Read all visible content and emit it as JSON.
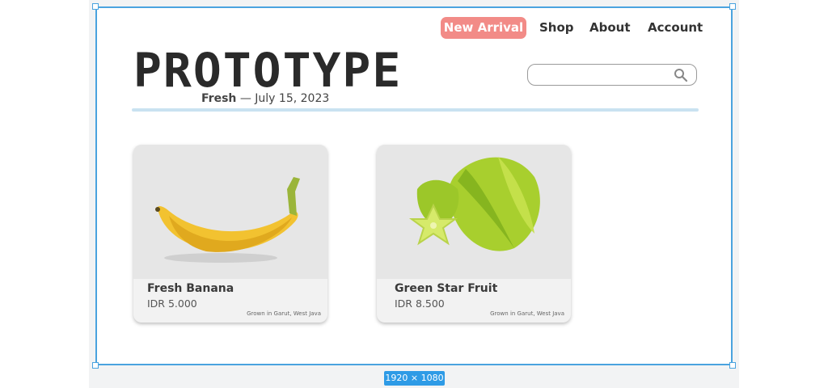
{
  "canvas": {
    "size_label": "1920 × 1080"
  },
  "nav": {
    "items": [
      {
        "label": "New Arrival",
        "highlighted": true,
        "color": "#f28b87"
      },
      {
        "label": "Shop"
      },
      {
        "label": "About"
      },
      {
        "label": "Account"
      }
    ]
  },
  "header": {
    "logo": "PROTOTYPE",
    "tagline_bold": "Fresh",
    "tagline_sep": "—",
    "tagline_date": "July 15, 2023"
  },
  "search": {
    "placeholder": "",
    "icon": "search-icon"
  },
  "products": [
    {
      "name": "Fresh Banana",
      "price": "IDR 5.000",
      "origin": "Grown in Garut, West Java",
      "image": "banana"
    },
    {
      "name": "Green Star Fruit",
      "price": "IDR 8.500",
      "origin": "Grown in Garut, West Java",
      "image": "star-fruit"
    }
  ],
  "colors": {
    "accent": "#f28b87",
    "selection": "#4aa3df",
    "divider": "#c9e2f1"
  }
}
